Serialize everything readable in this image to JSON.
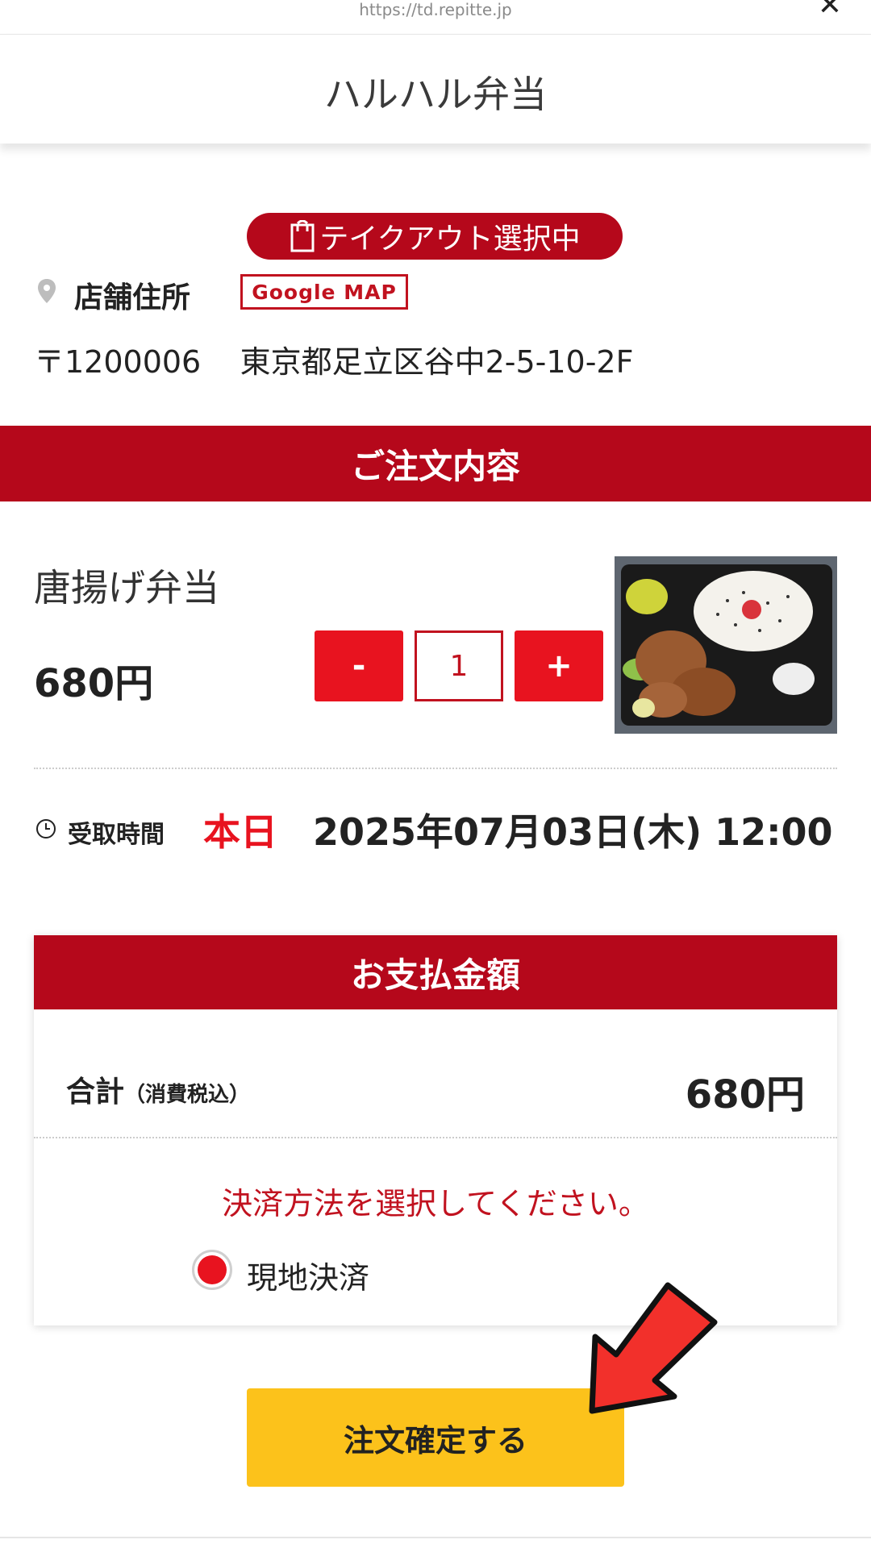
{
  "browser": {
    "url": "https://td.repitte.jp",
    "close_glyph": "✕"
  },
  "header": {
    "title": "ハルハル弁当"
  },
  "store": {
    "takeout_badge": "テイクアウト選択中",
    "address_label": "店舗住所",
    "map_button": "Google MAP",
    "postal_code": "〒1200006",
    "address": "東京都足立区谷中2-5-10-2F"
  },
  "order": {
    "section_title": "ご注文内容",
    "item": {
      "name": "唐揚げ弁当",
      "price": "680円",
      "quantity": "1"
    },
    "minus_label": "-",
    "plus_label": "+",
    "pickup_label": "受取時間",
    "pickup_today": "本日",
    "pickup_datetime": "2025年07月03日(木) 12:00"
  },
  "payment": {
    "section_title": "お支払金額",
    "total_label": "合計",
    "total_note": "（消費税込）",
    "total_value": "680円",
    "prompt": "決済方法を選択してください。",
    "method": "現地決済"
  },
  "confirm_button": "注文確定する",
  "colors": {
    "brand_red": "#b5081b",
    "button_red": "#e8131f",
    "confirm_yellow": "#fcc21b",
    "annotation_arrow": "#f2302b"
  },
  "icons": [
    "bag-icon",
    "map-pin-icon",
    "clock-icon",
    "close-icon",
    "arrow-annotation"
  ]
}
